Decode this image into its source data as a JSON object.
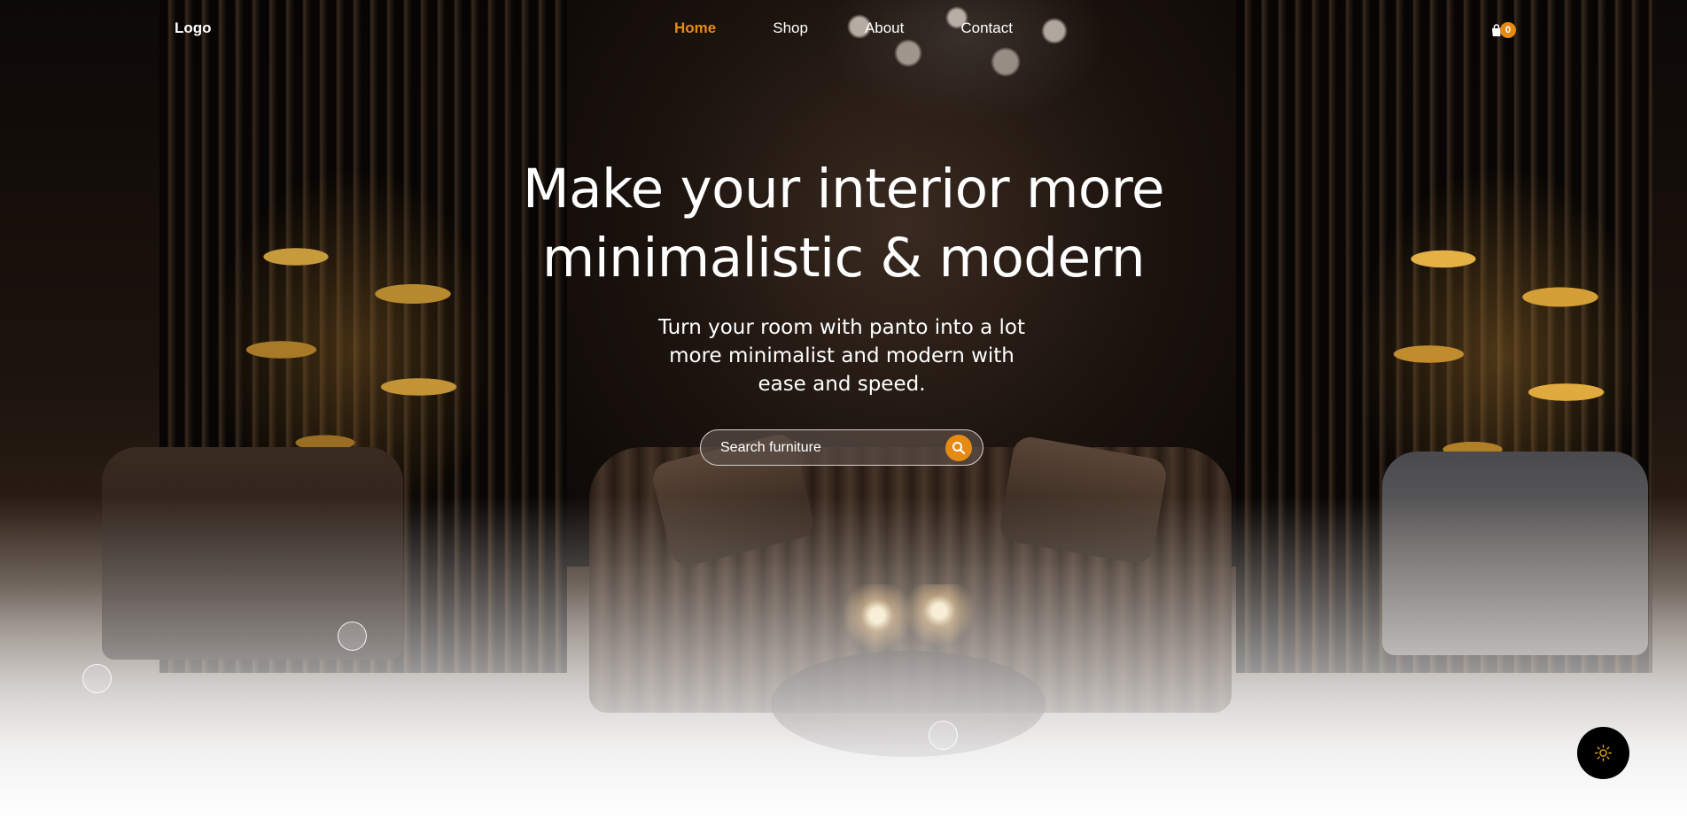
{
  "nav": {
    "logo": "Logo",
    "links": [
      {
        "label": "Home",
        "active": true
      },
      {
        "label": "Shop",
        "active": false
      },
      {
        "label": "About",
        "active": false
      },
      {
        "label": "Contact",
        "active": false
      }
    ],
    "cart_icon": "shopping-bag-icon",
    "cart_count": "0"
  },
  "hero": {
    "headline_line1": "Make your interior more",
    "headline_line2": "minimalistic & modern",
    "subtitle_line1": "Turn your room with panto into a lot",
    "subtitle_line2": "more minimalist and modern with",
    "subtitle_line3": "ease and speed.",
    "search": {
      "placeholder": "Search furniture",
      "button_icon": "search-icon"
    }
  },
  "theme_toggle": {
    "icon": "sun-icon"
  },
  "colors": {
    "accent": "#e58a12",
    "text_light": "#ffffff",
    "toggle_bg": "#000000"
  }
}
